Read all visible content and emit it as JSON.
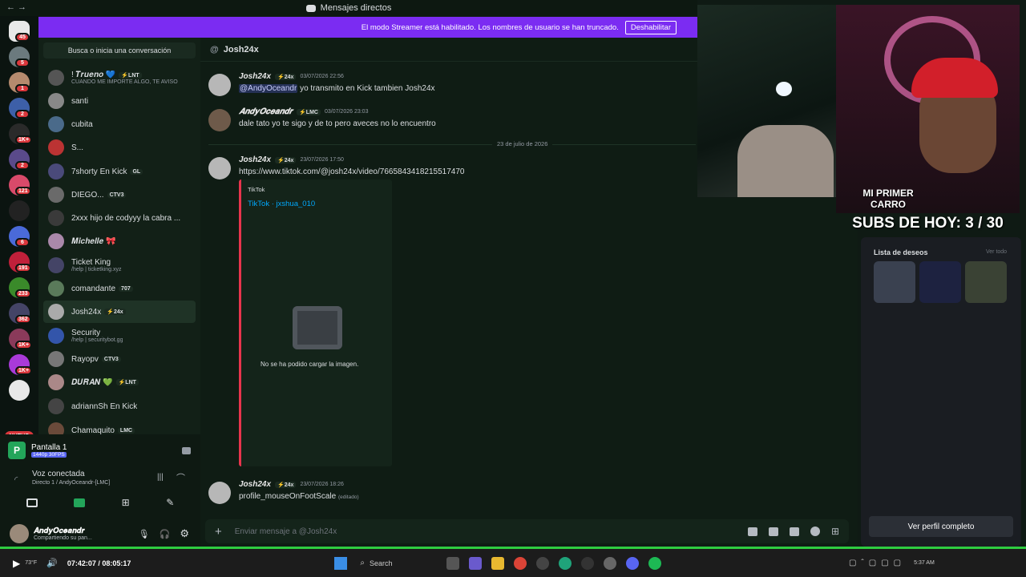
{
  "window": {
    "title": "Mensajes directos",
    "nav_arrows": "← →"
  },
  "streamer_banner": {
    "text": "El modo Streamer está habilitado. Los nombres de usuario se han truncado.",
    "button": "Deshabilitar"
  },
  "servers": {
    "badges": [
      "45",
      "5",
      "1",
      "2",
      "1K+",
      "2",
      "121",
      "6",
      "191",
      "233",
      "362",
      "1K+",
      "1K+"
    ],
    "new_label": "NUEVO"
  },
  "dm_sidebar": {
    "search_placeholder": "Busca o inicia una conversación",
    "items": [
      {
        "name": "! 𝑻𝒓𝒖𝒆𝒏𝒐 💙",
        "tag": "⚡LNT",
        "sub": "CUANDO ME IMPORTE ALGO, TE AVISO"
      },
      {
        "name": "santi",
        "tag": "",
        "sub": ""
      },
      {
        "name": "cubita",
        "tag": "",
        "sub": ""
      },
      {
        "name": "S...",
        "tag": "",
        "sub": ""
      },
      {
        "name": "7shorty En Kick",
        "tag": "GL",
        "sub": ""
      },
      {
        "name": "DIEGO...",
        "tag": "CTV3",
        "sub": ""
      },
      {
        "name": "2xxx hijo de codyyy la cabra ...",
        "tag": "",
        "sub": ""
      },
      {
        "name": "𝑴𝒊𝒄𝒉𝒆𝒍𝒍𝒆 🎀",
        "tag": "",
        "sub": ""
      },
      {
        "name": "Ticket King",
        "tag": "",
        "sub": "/help | ticketking.xyz"
      },
      {
        "name": "comandante",
        "tag": "707",
        "sub": ""
      },
      {
        "name": "Josh24x",
        "tag": "⚡24x",
        "sub": ""
      },
      {
        "name": "Security",
        "tag": "",
        "sub": "/help | securitybot.gg"
      },
      {
        "name": "Rayopv",
        "tag": "CTV3",
        "sub": ""
      },
      {
        "name": "𝑫𝑼𝑹𝑨𝑵 💚",
        "tag": "⚡LNT",
        "sub": ""
      },
      {
        "name": "adriannSh En Kick",
        "tag": "",
        "sub": ""
      },
      {
        "name": "Chamaquito",
        "tag": "LMC",
        "sub": ""
      }
    ]
  },
  "voice_panel": {
    "stream_title": "Pantalla 1",
    "stream_quality": "1440p 30FPS",
    "voice_status": "Voz conectada",
    "voice_channel": "Directo 1 / AndyOceandr-[LMC]",
    "username": "𝑨𝒏𝒅𝒚𝑶𝒄𝒆𝒂𝒏𝒅𝒓",
    "user_status": "Compartiendo su pan..."
  },
  "chat": {
    "header_name": "Josh24x",
    "messages": [
      {
        "author": "Josh24x",
        "tag": "⚡24x",
        "time": "03/07/2026 22:56",
        "mention": "@AndyOceandr",
        "text": " yo transmito en Kick tambien Josh24x"
      },
      {
        "author": "𝑨𝒏𝒅𝒚𝑶𝒄𝒆𝒂𝒏𝒅𝒓",
        "tag": "⚡LMC",
        "time": "03/07/2026 23:03",
        "mention": "",
        "text": "dale tato yo te sigo y de to pero aveces no lo encuentro"
      },
      {
        "author": "Josh24x",
        "tag": "⚡24x",
        "time": "23/07/2026 17:50",
        "mention": "",
        "text": "https://www.tiktok.com/@josh24x/video/7665843418215517470"
      },
      {
        "author": "Josh24x",
        "tag": "⚡24x",
        "time": "23/07/2026 18:26",
        "mention": "",
        "text": "profile_mouseOnFootScale",
        "edited": "(editado)"
      }
    ],
    "date_divider": "23 de julio de 2026",
    "embed": {
      "provider": "TikTok",
      "title": "TikTok · jxshua_010",
      "error": "No se ha podido cargar la imagen."
    },
    "input_placeholder": "Enviar mensaje a @Josh24x"
  },
  "overlay": {
    "subs_text": "SUBS DE HOY: 3 / 30",
    "banner_text": "MI PRIMER CARRO"
  },
  "profile_panel": {
    "wishlist_title": "Lista de deseos",
    "see_all": "Ver todo",
    "full_profile_button": "Ver perfil completo"
  },
  "taskbar": {
    "media_time": "07:42:07 / 08:05:17",
    "search_label": "Search",
    "clock": "5:37 AM",
    "weather": "73°F"
  },
  "colors": {
    "accent": "#5865f2",
    "streamer_banner": "#7b2cf2",
    "bg": "#0f1c14",
    "green": "#23a55a",
    "red": "#da373c"
  }
}
